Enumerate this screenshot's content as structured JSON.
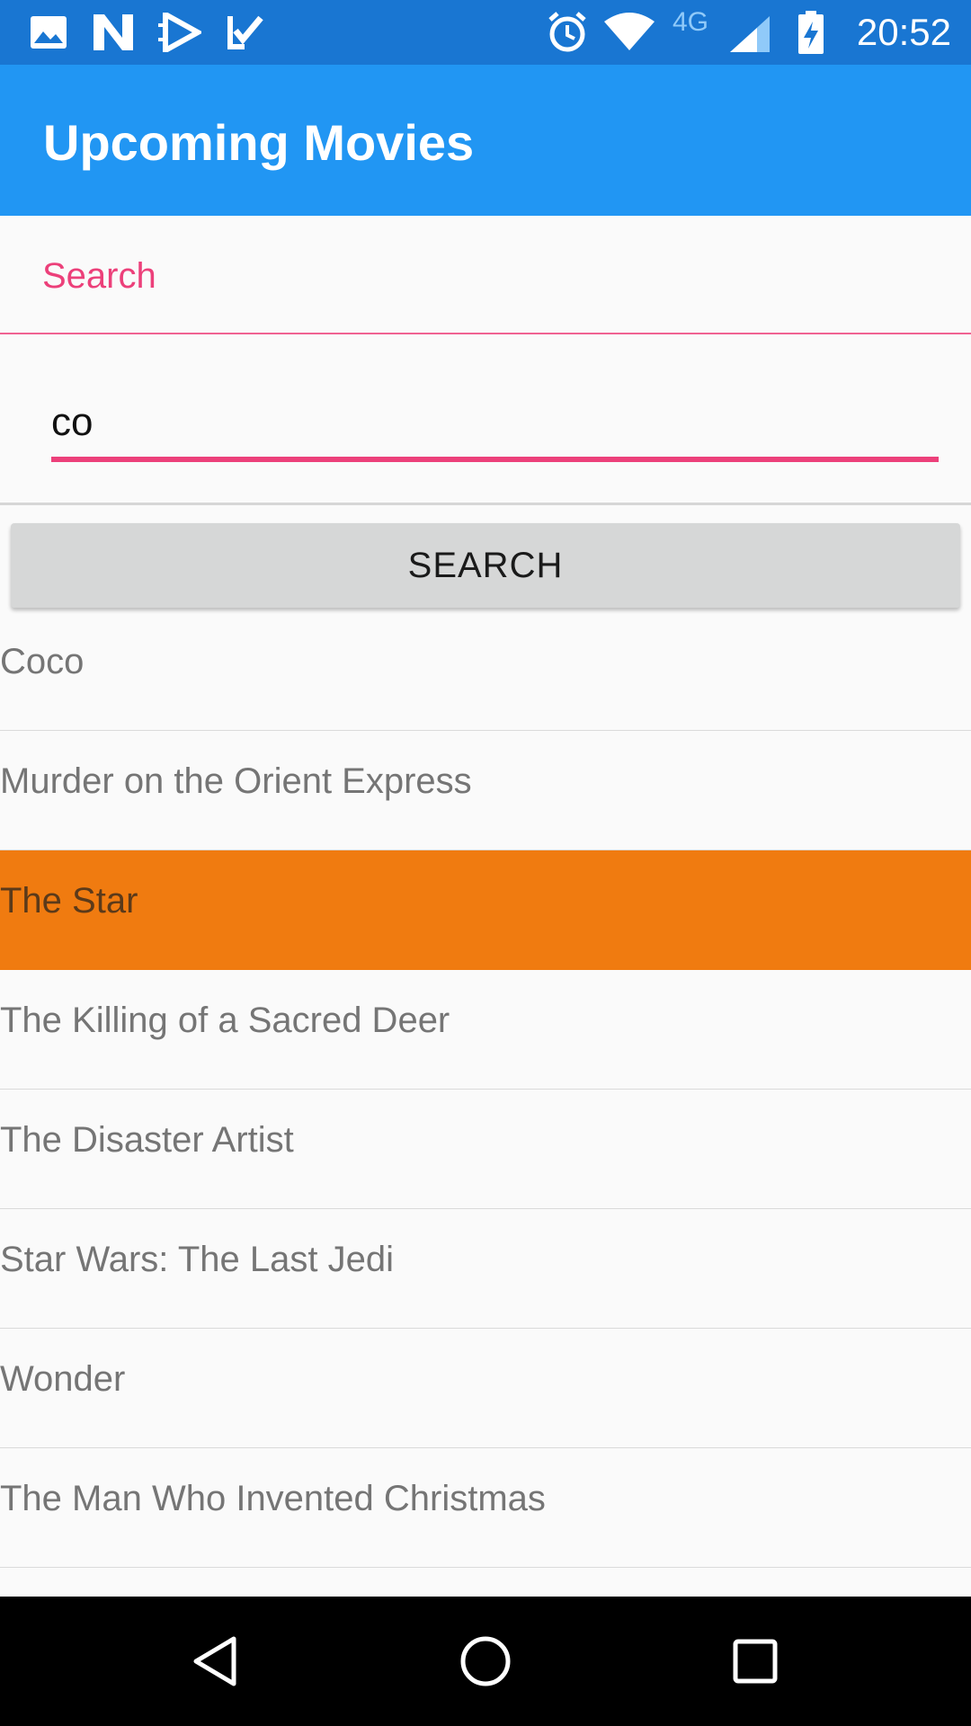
{
  "status_bar": {
    "time": "20:52",
    "network_label": "4G",
    "left_icons": [
      "image-icon",
      "n-icon",
      "play-store-icon",
      "task-check-icon"
    ],
    "right_icons": [
      "alarm-icon",
      "wifi-icon",
      "signal-icon",
      "battery-charging-icon"
    ]
  },
  "app_bar": {
    "title": "Upcoming Movies",
    "color": "#2196f3"
  },
  "search": {
    "label": "Search",
    "value": "co",
    "button_label": "SEARCH",
    "accent_color": "#ec407a"
  },
  "movies": [
    {
      "title": "Coco",
      "selected": false
    },
    {
      "title": "Murder on the Orient Express",
      "selected": false
    },
    {
      "title": "The Star",
      "selected": true
    },
    {
      "title": "The Killing of a Sacred Deer",
      "selected": false
    },
    {
      "title": "The Disaster Artist",
      "selected": false
    },
    {
      "title": "Star Wars: The Last Jedi",
      "selected": false
    },
    {
      "title": "Wonder",
      "selected": false
    },
    {
      "title": "The Man Who Invented Christmas",
      "selected": false
    }
  ],
  "selection_color": "#f07b10",
  "nav_bar": {
    "buttons": [
      "back-icon",
      "home-icon",
      "recents-icon"
    ]
  }
}
